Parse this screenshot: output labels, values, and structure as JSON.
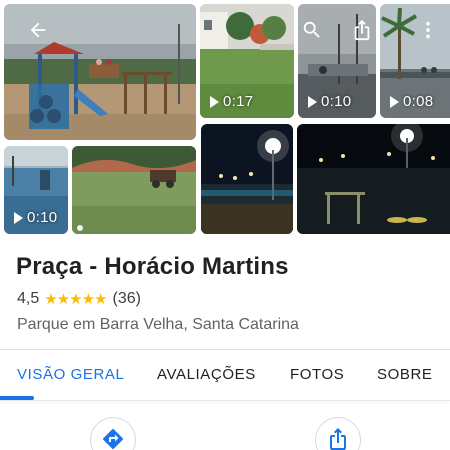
{
  "gallery": {
    "overlay_buttons": {
      "back_icon": "arrow-left-icon",
      "search_icon": "search-icon",
      "share_icon": "share-icon",
      "more_icon": "more-vertical-icon"
    },
    "videos": [
      {
        "duration": "0:17"
      },
      {
        "duration": "0:10"
      },
      {
        "duration": "0:08"
      },
      {
        "duration": "0:10"
      }
    ]
  },
  "place": {
    "name": "Praça - Horácio Martins",
    "rating": "4,5",
    "stars": "★★★★★",
    "review_count": "(36)",
    "category_location": "Parque em Barra Velha, Santa Catarina"
  },
  "tabs": [
    {
      "label": "VISÃO GERAL",
      "active": true
    },
    {
      "label": "AVALIAÇÕES",
      "active": false
    },
    {
      "label": "FOTOS",
      "active": false
    },
    {
      "label": "SOBRE",
      "active": false
    }
  ],
  "actions": [
    {
      "icon": "directions-icon"
    },
    {
      "icon": "share-icon"
    }
  ],
  "colors": {
    "accent": "#1a73e8",
    "star": "#fbbc04",
    "title": "#202124",
    "secondary_text": "#5f6368"
  }
}
